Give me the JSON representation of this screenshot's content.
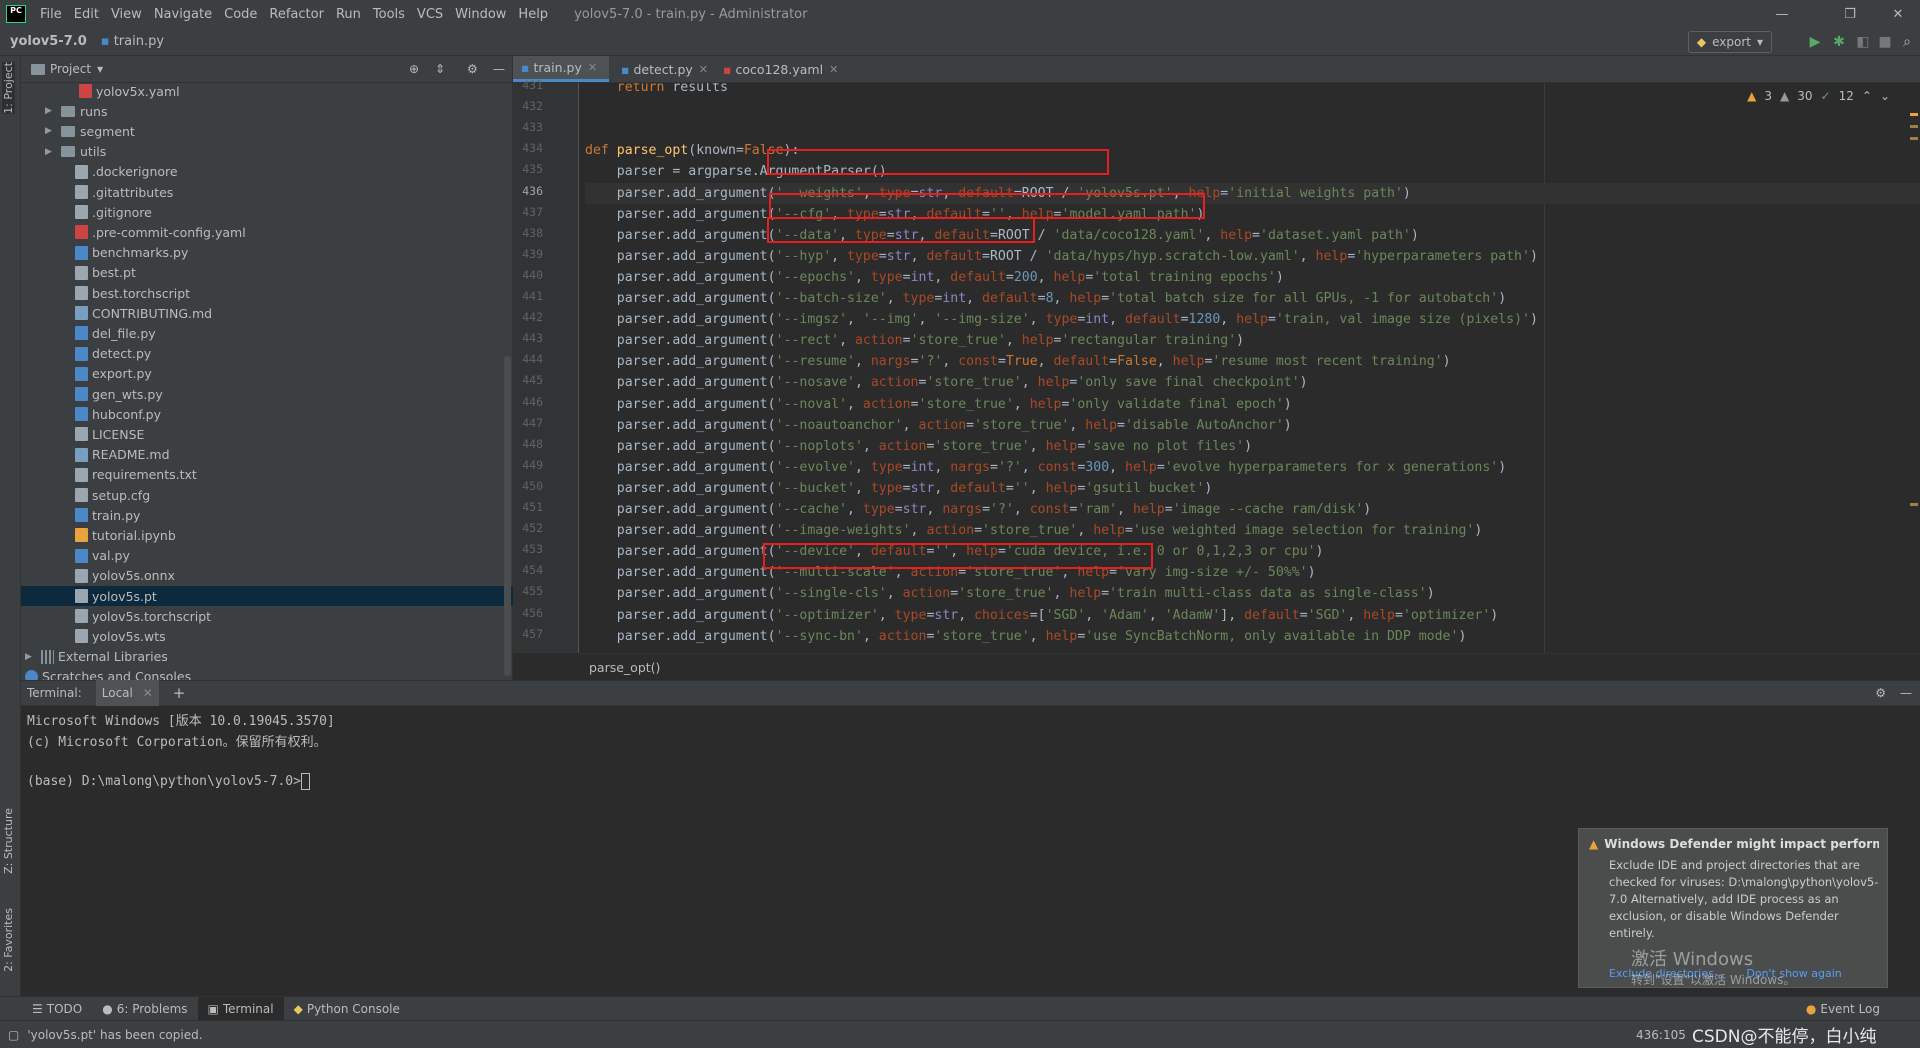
{
  "window": {
    "title": "yolov5-7.0 - train.py - Administrator",
    "logo": "PC",
    "menu": [
      "File",
      "Edit",
      "View",
      "Navigate",
      "Code",
      "Refactor",
      "Run",
      "Tools",
      "VCS",
      "Window",
      "Help"
    ]
  },
  "navbar": {
    "project": "yolov5-7.0",
    "file": "train.py",
    "run_config": "export"
  },
  "left_stripe": {
    "project_tab": "1: Project",
    "structure_tab": "Z: Structure",
    "favorites_tab": "2: Favorites"
  },
  "project_panel": {
    "title": "Project",
    "items": [
      {
        "name": "yolov5x.yaml",
        "type": "yaml"
      },
      {
        "name": "runs",
        "type": "folder"
      },
      {
        "name": "segment",
        "type": "folder"
      },
      {
        "name": "utils",
        "type": "folder"
      },
      {
        "name": ".dockerignore",
        "type": "file"
      },
      {
        "name": ".gitattributes",
        "type": "file"
      },
      {
        "name": ".gitignore",
        "type": "file"
      },
      {
        "name": ".pre-commit-config.yaml",
        "type": "yaml"
      },
      {
        "name": "benchmarks.py",
        "type": "py"
      },
      {
        "name": "best.pt",
        "type": "file"
      },
      {
        "name": "best.torchscript",
        "type": "file"
      },
      {
        "name": "CONTRIBUTING.md",
        "type": "md"
      },
      {
        "name": "del_file.py",
        "type": "py"
      },
      {
        "name": "detect.py",
        "type": "py"
      },
      {
        "name": "export.py",
        "type": "py"
      },
      {
        "name": "gen_wts.py",
        "type": "py"
      },
      {
        "name": "hubconf.py",
        "type": "py"
      },
      {
        "name": "LICENSE",
        "type": "file"
      },
      {
        "name": "README.md",
        "type": "md"
      },
      {
        "name": "requirements.txt",
        "type": "txt"
      },
      {
        "name": "setup.cfg",
        "type": "file"
      },
      {
        "name": "train.py",
        "type": "py"
      },
      {
        "name": "tutorial.ipynb",
        "type": "ipynb"
      },
      {
        "name": "val.py",
        "type": "py"
      },
      {
        "name": "yolov5s.onnx",
        "type": "file"
      },
      {
        "name": "yolov5s.pt",
        "type": "file"
      },
      {
        "name": "yolov5s.torchscript",
        "type": "file"
      },
      {
        "name": "yolov5s.wts",
        "type": "file"
      },
      {
        "name": "External Libraries",
        "type": "lib"
      },
      {
        "name": "Scratches and Consoles",
        "type": "scratch"
      }
    ]
  },
  "editor": {
    "tabs": [
      "train.py",
      "detect.py",
      "coco128.yaml"
    ],
    "inspections": {
      "warnings": "3",
      "weak_warnings": "30",
      "ok": "12"
    },
    "line_numbers": [
      "431",
      "432",
      "433",
      "434",
      "435",
      "436",
      "437",
      "438",
      "439",
      "440",
      "441",
      "442",
      "443",
      "444",
      "445",
      "446",
      "447",
      "448",
      "449",
      "450",
      "451",
      "452",
      "453",
      "454",
      "455",
      "456",
      "457"
    ],
    "breadcrumb": "parse_opt()"
  },
  "terminal": {
    "label": "Terminal:",
    "tab": "Local",
    "lines": [
      "Microsoft Windows [版本 10.0.19045.3570]",
      "(c) Microsoft Corporation。保留所有权利。",
      "",
      "(base) D:\\malong\\python\\yolov5-7.0>"
    ]
  },
  "notification": {
    "title": "Windows Defender might impact performanc",
    "body": "Exclude IDE and project directories that are checked for viruses: D:\\malong\\python\\yolov5-7.0 Alternatively, add IDE process as an exclusion, or disable Windows Defender entirely.",
    "action1": "Exclude directories...",
    "action2": "Don't show again",
    "activate1": "激活 Windows",
    "activate2": "转到\"设置\"以激活 Windows。"
  },
  "bottom_tools": [
    "TODO",
    "6: Problems",
    "Terminal",
    "Python Console"
  ],
  "event_log": "Event Log",
  "status": {
    "message": "'yolov5s.pt' has been copied.",
    "position": "436:105",
    "watermark": "CSDN@不能停，白小纯"
  },
  "colors": {
    "keyword": "#cc7832",
    "string": "#6a8759",
    "number": "#6897bb",
    "highlight_box": "#e5201f",
    "selection": "#0d293e"
  }
}
